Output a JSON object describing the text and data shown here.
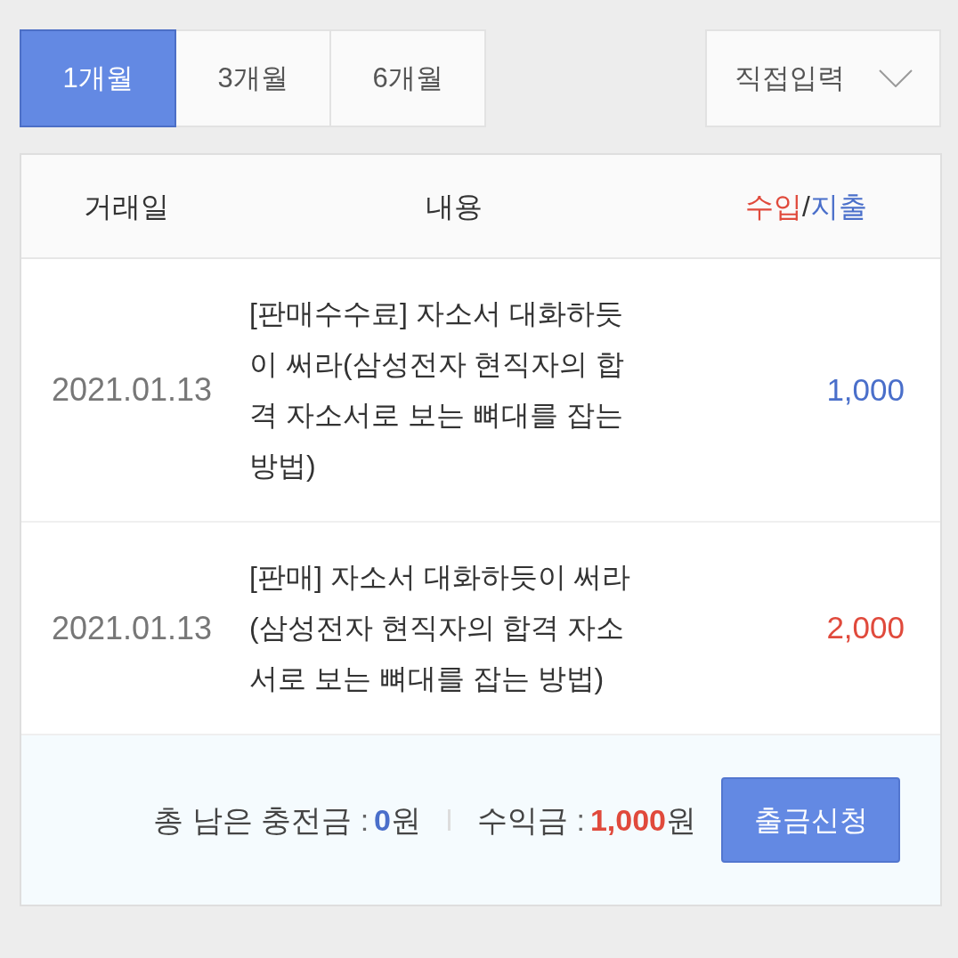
{
  "period_tabs": [
    {
      "label": "1개월",
      "selected": true
    },
    {
      "label": "3개월",
      "selected": false
    },
    {
      "label": "6개월",
      "selected": false
    }
  ],
  "custom_period_dropdown": {
    "label": "직접입력"
  },
  "table": {
    "columns": [
      {
        "label_parts": [
          {
            "text": "거래일",
            "kind": "plain"
          }
        ]
      },
      {
        "label_parts": [
          {
            "text": "내용",
            "kind": "plain"
          }
        ]
      },
      {
        "label_parts": [
          {
            "text": "수입",
            "kind": "income"
          },
          {
            "text": "/",
            "kind": "plain"
          },
          {
            "text": "지출",
            "kind": "expense"
          }
        ]
      }
    ],
    "rows": [
      {
        "date": "2021.01.13",
        "description": "[판매수수료] 자소서 대화하듯이 써라(삼성전자 현직자의 합격 자소서로 보는 뼈대를 잡는 방법)",
        "amount": "1,000",
        "kind": "expense"
      },
      {
        "date": "2021.01.13",
        "description": "[판매] 자소서 대화하듯이 써라(삼성전자 현직자의 합격 자소서로 보는 뼈대를 잡는 방법)",
        "amount": "2,000",
        "kind": "income"
      }
    ]
  },
  "summary": {
    "items": [
      {
        "label": "총 남은 충전금",
        "colon": ":",
        "value": "0",
        "unit": "원",
        "kind": "balance"
      },
      {
        "label": "수익금",
        "colon": ":",
        "value": "1,000",
        "unit": "원",
        "kind": "earnings"
      }
    ],
    "button": "출금신청"
  }
}
